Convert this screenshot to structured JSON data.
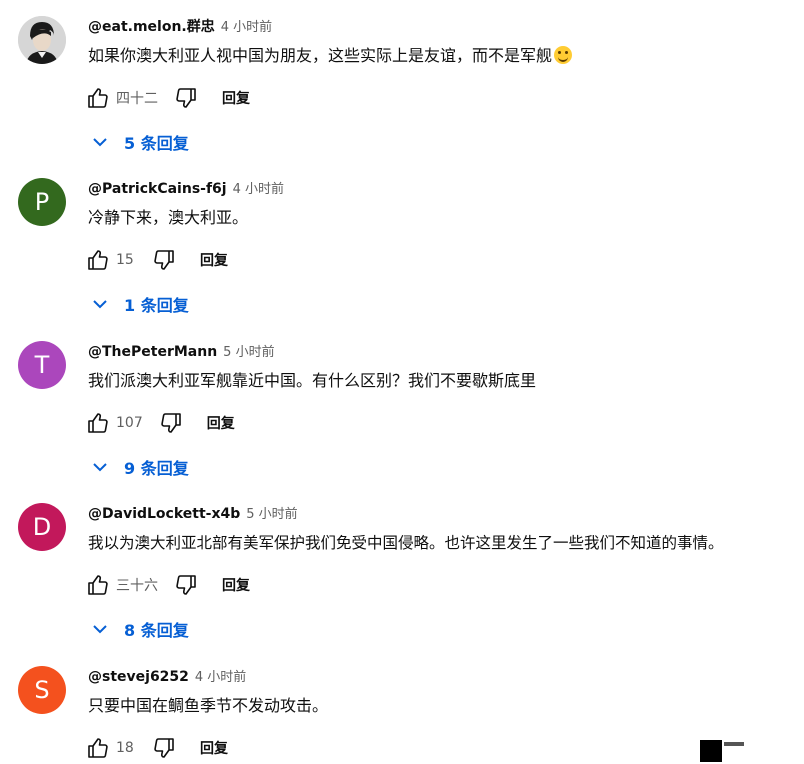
{
  "colors": {
    "link": "#065fd4",
    "meta": "#606060",
    "text": "#0f0f0f"
  },
  "icons": {
    "like": "thumb-up-icon",
    "dislike": "thumb-down-icon",
    "expand": "chevron-down-icon"
  },
  "reply_label": "回复",
  "comments": [
    {
      "author": "@eat.melon.群忠",
      "time": "4 小时前",
      "avatar_letter": "",
      "avatar_color": "#d9d9d9",
      "text": "如果你澳大利亚人视中国为朋友，这些实际上是友谊，而不是军舰",
      "likes": "四十二",
      "replies": "5 条回复"
    },
    {
      "author": "@PatrickCains-f6j",
      "time": "4 小时前",
      "avatar_letter": "P",
      "avatar_color": "#33691e",
      "text": "冷静下来，澳大利亚。",
      "likes": "15",
      "replies": "1 条回复"
    },
    {
      "author": "@ThePeterMann",
      "time": "5 小时前",
      "avatar_letter": "T",
      "avatar_color": "#ab47bc",
      "text": "我们派澳大利亚军舰靠近中国。有什么区别？我们不要歇斯底里",
      "likes": "107",
      "replies": "9 条回复"
    },
    {
      "author": "@DavidLockett-x4b",
      "time": "5 小时前",
      "avatar_letter": "D",
      "avatar_color": "#c2185b",
      "text": "我以为澳大利亚北部有美军保护我们免受中国侵略。也许这里发生了一些我们不知道的事情。",
      "likes": "三十六",
      "replies": "8 条回复"
    },
    {
      "author": "@stevej6252",
      "time": "4 小时前",
      "avatar_letter": "S",
      "avatar_color": "#f4511e",
      "text": "只要中国在鲷鱼季节不发动攻击。",
      "likes": "18",
      "replies": ""
    }
  ]
}
